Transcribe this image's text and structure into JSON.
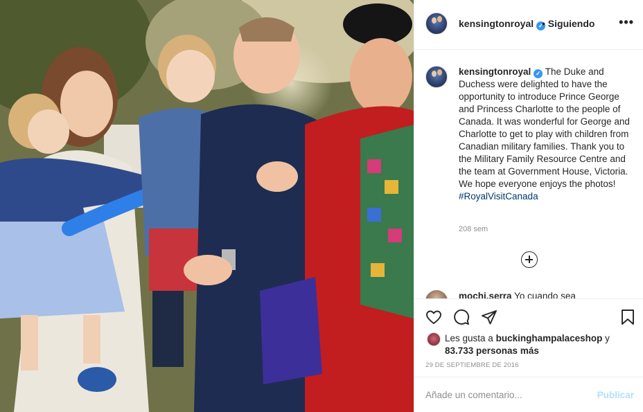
{
  "photo": {
    "icon": "royal-family-photo"
  },
  "header": {
    "username": "kensingtonroyal",
    "verified_icon": "verified-badge-icon",
    "follow_status": "• Siguiendo",
    "more_icon": "more-options-icon"
  },
  "caption": {
    "username": "kensingtonroyal",
    "text": "The Duke and Duchess were delighted to have the opportunity to introduce Prince George and Princess Charlotte to the people of Canada. It was wonderful for George and Charlotte to get to play with children from Canadian military families. Thank you to the Military Family Resource Centre and the team at Government House, Victoria. We hope everyone enjoys the photos!",
    "hashtag": "#RoyalVisitCanada",
    "age": "208 sem"
  },
  "load_more_icon": "plus-circle-icon",
  "reply": {
    "username": "mochi.serra",
    "text": "Yo cuando sea"
  },
  "actions": {
    "like_icon": "heart-icon",
    "comment_icon": "comment-icon",
    "share_icon": "share-icon",
    "save_icon": "bookmark-icon"
  },
  "likes": {
    "prefix": "Les gusta a",
    "user": "buckinghampalaceshop",
    "middle": "y",
    "count": "83.733 personas más"
  },
  "date": "29 DE SEPTIEMBRE DE 2016",
  "add_comment": {
    "placeholder": "Añade un comentario...",
    "publish": "Publicar"
  },
  "colors": {
    "link": "#00376b",
    "verified": "#3897f0",
    "publish_disabled": "#b2dffc",
    "muted": "#8e8e8e"
  }
}
